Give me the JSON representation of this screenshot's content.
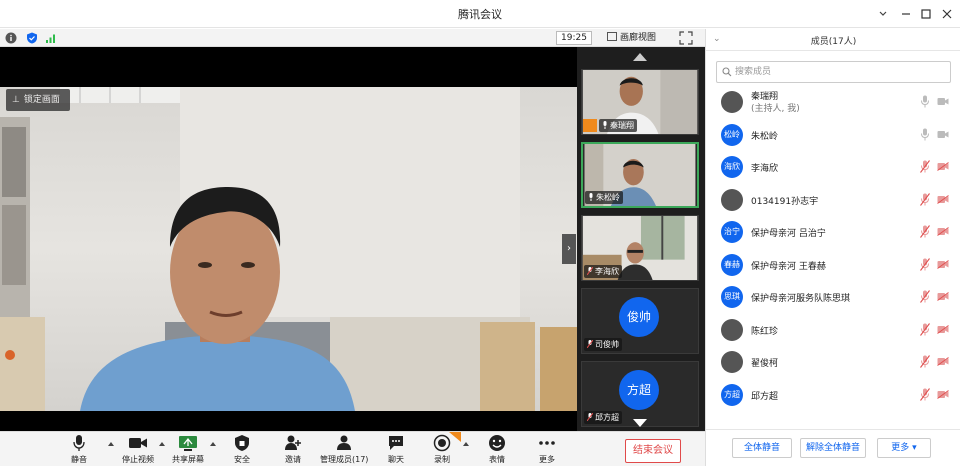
{
  "window": {
    "title": "腾讯会议"
  },
  "infobar": {
    "time": "19:25",
    "gallery_label": "画廊视图"
  },
  "main_video": {
    "lock_label": "锁定画面"
  },
  "thumbnails": [
    {
      "name": "秦瑞翔",
      "type": "video"
    },
    {
      "name": "朱松岭",
      "type": "video"
    },
    {
      "name": "李海欣",
      "type": "video"
    },
    {
      "name": "司俊帅",
      "type": "avatar",
      "avatar_text": "俊帅"
    },
    {
      "name": "邱方超",
      "type": "avatar",
      "avatar_text": "方超"
    }
  ],
  "toolbar": {
    "mute": "静音",
    "stop_video": "停止视频",
    "share_screen": "共享屏幕",
    "security": "安全",
    "invite": "邀请",
    "manage_members": "管理成员(17)",
    "chat": "聊天",
    "record": "录制",
    "reactions": "表情",
    "more": "更多",
    "end_meeting": "结束会议"
  },
  "panel": {
    "title": "成员(17人)",
    "search_placeholder": "搜索成员",
    "members": [
      {
        "name": "秦瑞翔",
        "sub": "(主持人, 我)",
        "avatar": "",
        "photo": true,
        "muted": false
      },
      {
        "name": "朱松岭",
        "avatar": "松岭",
        "photo": false,
        "muted": false
      },
      {
        "name": "李海欣",
        "avatar": "海欣",
        "photo": false,
        "muted": true
      },
      {
        "name": "0134191孙志宇",
        "avatar": "",
        "photo": true,
        "muted": true
      },
      {
        "name": "保护母亲河 吕治宁",
        "avatar": "治宁",
        "photo": false,
        "muted": true
      },
      {
        "name": "保护母亲河 王春赫",
        "avatar": "春赫",
        "photo": false,
        "muted": true
      },
      {
        "name": "保护母亲河服务队陈思琪",
        "avatar": "思琪",
        "photo": false,
        "muted": true
      },
      {
        "name": "陈红珍",
        "avatar": "",
        "photo": true,
        "muted": true
      },
      {
        "name": "翟俊柯",
        "avatar": "",
        "photo": true,
        "muted": true
      },
      {
        "name": "邱方超",
        "avatar": "方超",
        "photo": false,
        "muted": true
      }
    ],
    "footer": {
      "mute_all": "全体静音",
      "unmute_all": "解除全体静音",
      "more": "更多"
    }
  },
  "colors": {
    "accent": "#1166ee",
    "end_red": "#e04a4a",
    "muted_red": "#e05050",
    "active_green": "#3ca85a"
  }
}
